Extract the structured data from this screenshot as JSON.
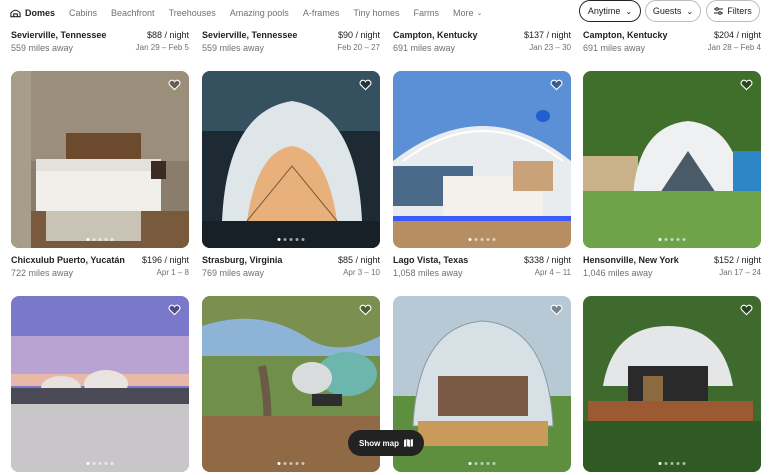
{
  "categories": [
    {
      "label": "Domes",
      "active": true
    },
    {
      "label": "Cabins"
    },
    {
      "label": "Beachfront"
    },
    {
      "label": "Treehouses"
    },
    {
      "label": "Amazing pools"
    },
    {
      "label": "A-frames"
    },
    {
      "label": "Tiny homes"
    },
    {
      "label": "Farms"
    },
    {
      "label": "More"
    }
  ],
  "filters": {
    "anytime": "Anytime",
    "guests": "Guests",
    "filters": "Filters"
  },
  "listings": [
    {
      "location": "Sevierville, Tennessee",
      "price": "$88 / night",
      "distance": "559 miles away",
      "dates": "Jan 29 – Feb 5"
    },
    {
      "location": "Sevierville, Tennessee",
      "price": "$90 / night",
      "distance": "559 miles away",
      "dates": "Feb 20 – 27"
    },
    {
      "location": "Campton, Kentucky",
      "price": "$137 / night",
      "distance": "691 miles away",
      "dates": "Jan 23 – 30"
    },
    {
      "location": "Campton, Kentucky",
      "price": "$204 / night",
      "distance": "691 miles away",
      "dates": "Jan 28 – Feb 4"
    },
    {
      "location": "Chicxulub Puerto, Yucatán",
      "price": "$196 / night",
      "distance": "722 miles away",
      "dates": "Apr 1 – 8"
    },
    {
      "location": "Strasburg, Virginia",
      "price": "$85 / night",
      "distance": "769 miles away",
      "dates": "Apr 3 – 10"
    },
    {
      "location": "Lago Vista, Texas",
      "price": "$338 / night",
      "distance": "1,058 miles away",
      "dates": "Apr 4 – 11"
    },
    {
      "location": "Hensonville, New York",
      "price": "$152 / night",
      "distance": "1,046 miles away",
      "dates": "Jan 17 – 24"
    },
    {},
    {},
    {},
    {}
  ],
  "show_map": "Show map",
  "colors": {
    "brand": "#222222",
    "muted": "#717171",
    "border": "#dddddd"
  }
}
